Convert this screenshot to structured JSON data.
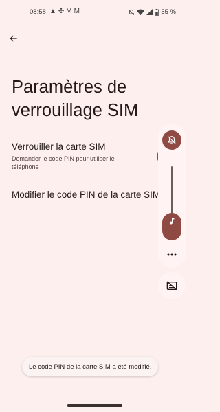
{
  "status_bar": {
    "time": "08:58",
    "left_icons": [
      "warning-icon",
      "fan-icon",
      "gmail-icon",
      "gmail-icon"
    ],
    "right_icons": [
      "mute-icon",
      "wifi-icon",
      "signal-icon",
      "battery-icon"
    ],
    "battery": "55 %"
  },
  "header": {
    "back_icon": "back-arrow-icon"
  },
  "main": {
    "title": "Paramètres de verrouillage SIM",
    "lock_sim": {
      "title": "Verrouiller la carte SIM",
      "subtitle": "Demander le code PIN pour utiliser le téléphone"
    },
    "change_pin": {
      "title": "Modifier le code PIN de la carte SIM"
    }
  },
  "volume_panel": {
    "ringer_mode_icon": "bell-off-icon",
    "media_icon": "music-note-icon",
    "more_icon": "more-dots-icon",
    "captions_icon": "captions-off-icon",
    "level": 0.2
  },
  "toast": {
    "text": "Le code PIN de la carte SIM a été modifié."
  },
  "colors": {
    "background": "#fcefee",
    "accent": "#904a44"
  }
}
